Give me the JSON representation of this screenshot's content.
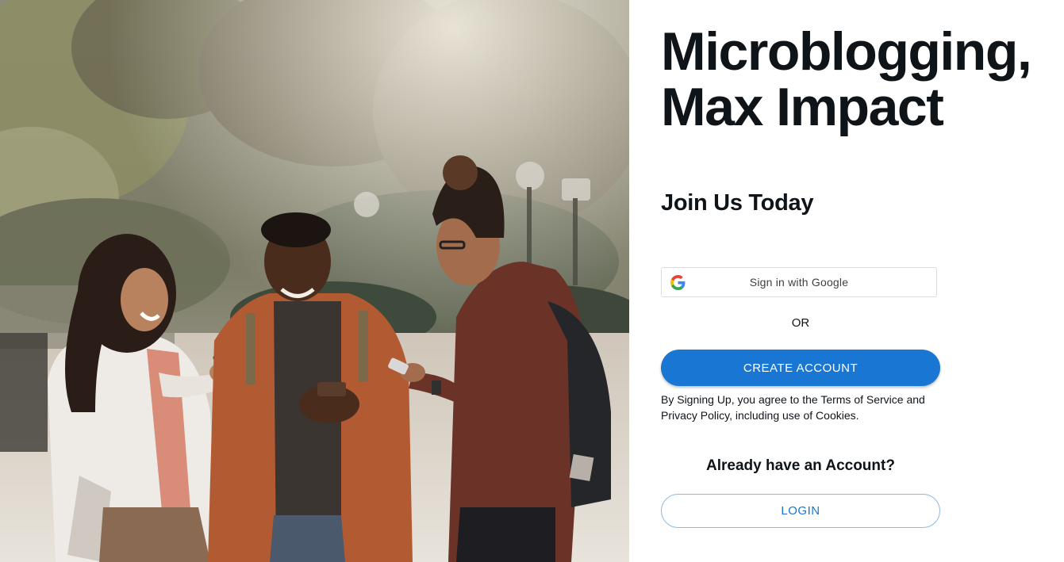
{
  "hero": {
    "image_alt": "three friends smiling at their phones in a park",
    "headline_line1": "Microblogging,",
    "headline_line2": "Max Impact"
  },
  "signup": {
    "title": "Join Us Today",
    "google_label": "Sign in with Google",
    "divider_text": "OR",
    "create_label": "CREATE ACCOUNT",
    "terms_text": "By Signing Up, you agree to the Terms of Service and Privacy Policy, including use of Cookies."
  },
  "login": {
    "prompt": "Already have an Account?",
    "button_label": "LOGIN"
  },
  "colors": {
    "primary": "#1976d2",
    "text": "#0f1419",
    "google_border": "#dadce0"
  },
  "icons": {
    "google": "google-g-icon"
  }
}
